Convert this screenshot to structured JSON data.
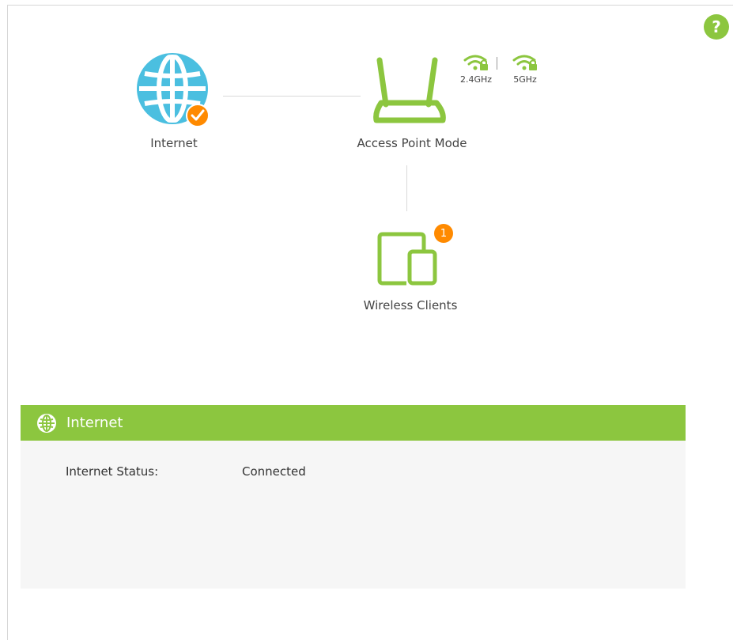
{
  "colors": {
    "accent": "#8cc63f",
    "globe": "#4bbfe0",
    "badge": "#ff8a00"
  },
  "help": {
    "label": "?"
  },
  "topology": {
    "internet": {
      "label": "Internet",
      "icon": "globe-icon",
      "status_icon": "check-icon"
    },
    "router": {
      "label": "Access Point Mode",
      "icon": "router-icon",
      "bands": [
        {
          "label": "2.4GHz",
          "icon": "wifi-lock-icon"
        },
        {
          "label": "5GHz",
          "icon": "wifi-lock-icon"
        }
      ]
    },
    "clients": {
      "label": "Wireless Clients",
      "icon": "devices-icon",
      "count": "1"
    }
  },
  "panel": {
    "title": "Internet",
    "icon": "globe-icon",
    "rows": [
      {
        "label": "Internet Status:",
        "value": "Connected"
      }
    ]
  }
}
